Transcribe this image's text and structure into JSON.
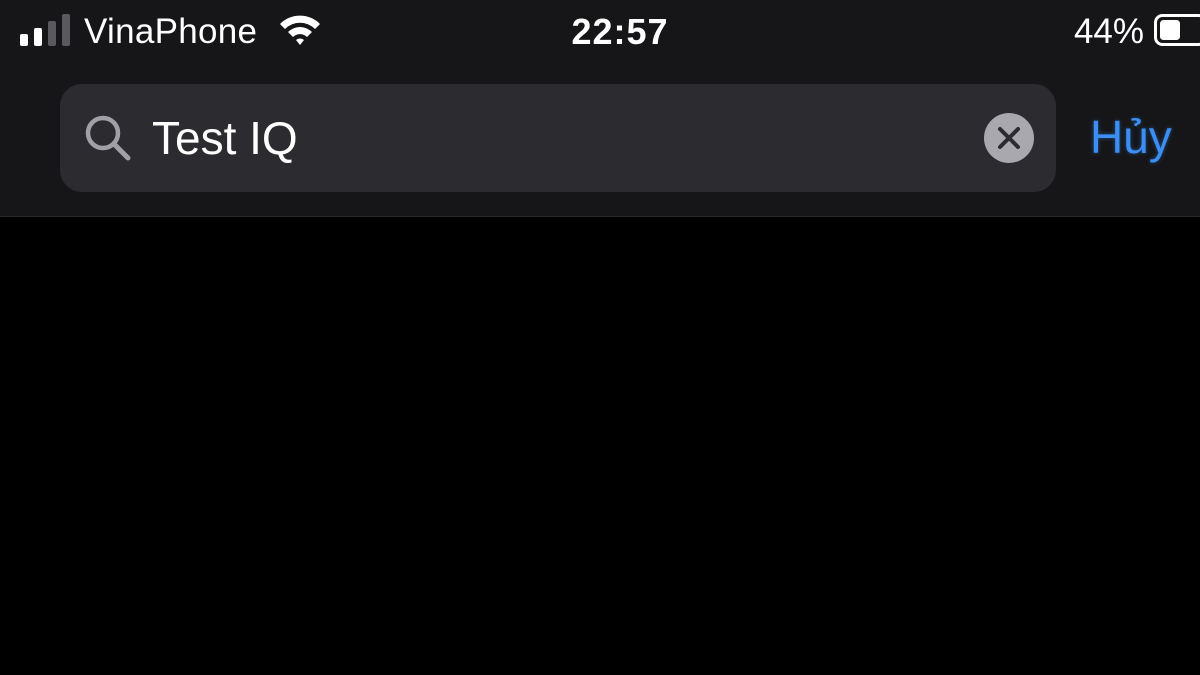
{
  "status_bar": {
    "carrier": "VinaPhone",
    "time": "22:57",
    "battery_percent": "44%",
    "battery_level": 0.44,
    "signal_bars_active": 2,
    "signal_bars_total": 4
  },
  "search": {
    "query": "Test IQ",
    "cancel_label": "Hủy",
    "icons": {
      "search": "search-icon",
      "clear": "clear-icon"
    }
  },
  "colors": {
    "accent": "#3a8ef5",
    "header_background": "#161618",
    "field_background": "#2c2c30",
    "page_background": "#000000"
  }
}
